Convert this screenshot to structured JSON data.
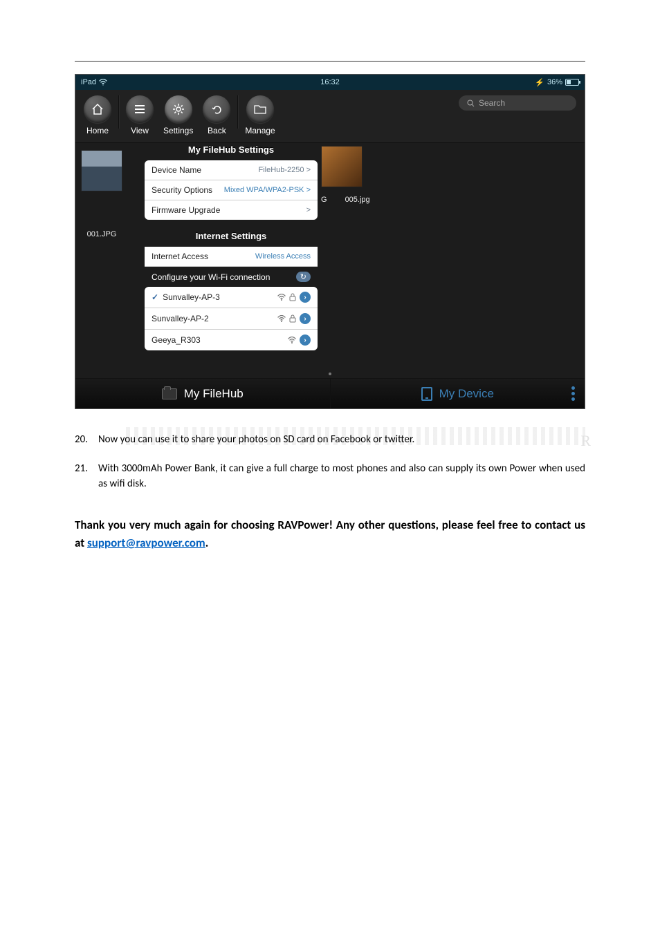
{
  "statusbar": {
    "device": "iPad",
    "time": "16:32",
    "battery_pct": "36%"
  },
  "toolbar": {
    "home": "Home",
    "view": "View",
    "settings": "Settings",
    "back": "Back",
    "manage": "Manage",
    "search_placeholder": "Search"
  },
  "thumbs": {
    "left_label": "001.JPG",
    "right_labels": [
      "G",
      "005.jpg"
    ]
  },
  "filehub_settings": {
    "heading": "My FileHub Settings",
    "rows": [
      {
        "label": "Device Name",
        "value": "FileHub-2250 >"
      },
      {
        "label": "Security Options",
        "value": "Mixed WPA/WPA2-PSK >"
      },
      {
        "label": "Firmware Upgrade",
        "value": ">"
      }
    ]
  },
  "internet_settings": {
    "heading": "Internet Settings",
    "access_row": {
      "label": "Internet Access",
      "value": "Wireless Access"
    },
    "configure_label": "Configure your Wi-Fi connection",
    "refresh_glyph": "↻",
    "networks": [
      {
        "name": "Sunvalley-AP-3",
        "checked": true,
        "locked": true
      },
      {
        "name": "Sunvalley-AP-2",
        "checked": false,
        "locked": true
      },
      {
        "name": "Geeya_R303",
        "checked": false,
        "locked": false
      }
    ]
  },
  "bottom_tabs": {
    "filehub": "My FileHub",
    "device": "My Device"
  },
  "body": {
    "item20_num": "20.",
    "item20_txt": "Now you can use it to share your photos on SD card on Facebook or twitter.",
    "item21_num": "21.",
    "item21_txt": "With 3000mAh Power Bank, it can give a full charge to most phones and also can supply its own Power when used as wifi disk."
  },
  "thankyou": {
    "pre": "Thank you very much again for choosing RAVPower! Any other questions, please feel free to contact us at ",
    "email": "support@ravpower.com",
    "post": "."
  }
}
